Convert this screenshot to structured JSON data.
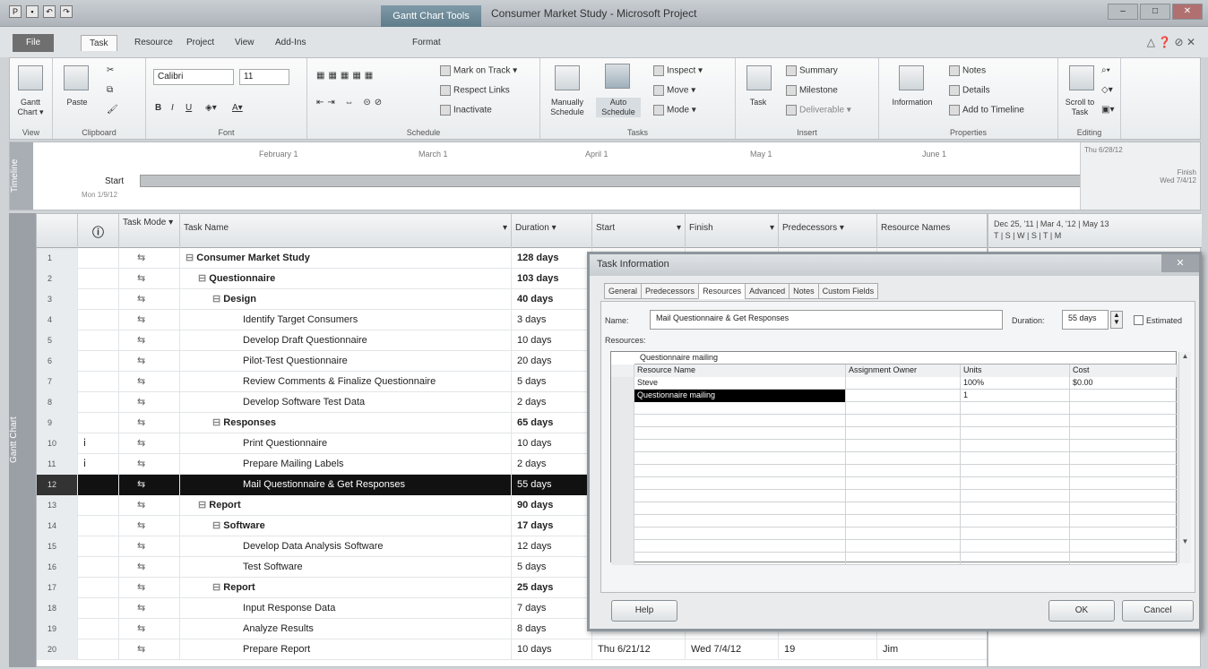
{
  "window": {
    "context_tab": "Gantt Chart Tools",
    "title": "Consumer Market Study - Microsoft Project"
  },
  "tabs": {
    "file": "File",
    "task": "Task",
    "resource": "Resource",
    "project": "Project",
    "view": "View",
    "addins": "Add-Ins",
    "format": "Format"
  },
  "ribbon": {
    "view": {
      "gantt_chart": "Gantt Chart ▾",
      "label": "View"
    },
    "clipboard": {
      "paste": "Paste",
      "label": "Clipboard"
    },
    "font": {
      "name": "Calibri",
      "size": "11",
      "label": "Font"
    },
    "schedule": {
      "mark_on_track": "Mark on Track ▾",
      "respect_links": "Respect Links",
      "inactivate": "Inactivate",
      "label": "Schedule"
    },
    "tasks": {
      "manually": "Manually Schedule",
      "auto": "Auto Schedule",
      "inspect": "Inspect ▾",
      "move": "Move ▾",
      "mode": "Mode ▾",
      "label": "Tasks"
    },
    "insert": {
      "task": "Task",
      "summary": "Summary",
      "milestone": "Milestone",
      "deliverable": "Deliverable ▾",
      "label": "Insert"
    },
    "properties": {
      "information": "Information",
      "notes": "Notes",
      "details": "Details",
      "add_to_timeline": "Add to Timeline",
      "label": "Properties"
    },
    "editing": {
      "scroll_to_task": "Scroll to Task",
      "label": "Editing"
    }
  },
  "timeline": {
    "vertical_label": "Timeline",
    "months": [
      "February 1",
      "March 1",
      "April 1",
      "May 1",
      "June 1"
    ],
    "start_label": "Start",
    "start_date": "Mon 1/9/12",
    "right_date": "Thu 6/28/12",
    "finish_label": "Finish",
    "finish_date": "Wed 7/4/12"
  },
  "gantt_label": "Gantt Chart",
  "columns": {
    "task_mode": "Task Mode",
    "task_name": "Task Name",
    "duration": "Duration",
    "start": "Start",
    "finish": "Finish",
    "predecessors": "Predecessors",
    "resource_names": "Resource Names"
  },
  "chart_header": {
    "weeks": "Dec 25, '11 | Mar 4, '12 | May 13",
    "days": "T | S | W | S | T | M"
  },
  "tasks": [
    {
      "id": "1",
      "name": "Consumer Market Study",
      "duration": "128 days",
      "level": 0,
      "summary": true
    },
    {
      "id": "2",
      "name": "Questionnaire",
      "duration": "103 days",
      "level": 1,
      "summary": true
    },
    {
      "id": "3",
      "name": "Design",
      "duration": "40 days",
      "level": 2,
      "summary": true
    },
    {
      "id": "4",
      "name": "Identify Target Consumers",
      "duration": "3 days",
      "level": 3,
      "summary": false
    },
    {
      "id": "5",
      "name": "Develop Draft Questionnaire",
      "duration": "10 days",
      "level": 3,
      "summary": false
    },
    {
      "id": "6",
      "name": "Pilot-Test Questionnaire",
      "duration": "20 days",
      "level": 3,
      "summary": false
    },
    {
      "id": "7",
      "name": "Review Comments & Finalize Questionnaire",
      "duration": "5 days",
      "level": 3,
      "summary": false
    },
    {
      "id": "8",
      "name": "Develop Software Test Data",
      "duration": "2 days",
      "level": 3,
      "summary": false
    },
    {
      "id": "9",
      "name": "Responses",
      "duration": "65 days",
      "level": 2,
      "summary": true
    },
    {
      "id": "10",
      "name": "Print Questionnaire",
      "duration": "10 days",
      "level": 3,
      "summary": false
    },
    {
      "id": "11",
      "name": "Prepare Mailing Labels",
      "duration": "2 days",
      "level": 3,
      "summary": false
    },
    {
      "id": "12",
      "name": "Mail Questionnaire & Get Responses",
      "duration": "55 days",
      "level": 3,
      "summary": false,
      "selected": true
    },
    {
      "id": "13",
      "name": "Report",
      "duration": "90 days",
      "level": 1,
      "summary": true
    },
    {
      "id": "14",
      "name": "Software",
      "duration": "17 days",
      "level": 2,
      "summary": true
    },
    {
      "id": "15",
      "name": "Develop Data Analysis Software",
      "duration": "12 days",
      "level": 3,
      "summary": false
    },
    {
      "id": "16",
      "name": "Test Software",
      "duration": "5 days",
      "level": 3,
      "summary": false
    },
    {
      "id": "17",
      "name": "Report",
      "duration": "25 days",
      "level": 2,
      "summary": true
    },
    {
      "id": "18",
      "name": "Input Response Data",
      "duration": "7 days",
      "level": 3,
      "summary": false
    },
    {
      "id": "19",
      "name": "Analyze Results",
      "duration": "8 days",
      "level": 3,
      "summary": false
    },
    {
      "id": "20",
      "name": "Prepare Report",
      "duration": "10 days",
      "level": 3,
      "summary": false,
      "start": "Thu 6/21/12",
      "finish": "Wed 7/4/12",
      "predecessors": "19",
      "resource": "Jim"
    }
  ],
  "dialog": {
    "title": "Task Information",
    "close": "✕",
    "tabs": [
      "General",
      "Predecessors",
      "Resources",
      "Advanced",
      "Notes",
      "Custom Fields"
    ],
    "name_label": "Name:",
    "name_value": "Mail Questionnaire & Get Responses",
    "duration_label": "Duration:",
    "duration_value": "55 days",
    "estimated_label": "Estimated",
    "resources_label": "Resources:",
    "edit_value": "Questionnaire mailing",
    "grid_headers": [
      "Resource Name",
      "Assignment Owner",
      "Units",
      "Cost"
    ],
    "rows": [
      {
        "name": "Steve",
        "owner": "",
        "units": "100%",
        "cost": "$0.00"
      },
      {
        "name": "Questionnaire mailing",
        "owner": "",
        "units": "1",
        "cost": ""
      }
    ],
    "help": "Help",
    "ok": "OK",
    "cancel": "Cancel"
  }
}
